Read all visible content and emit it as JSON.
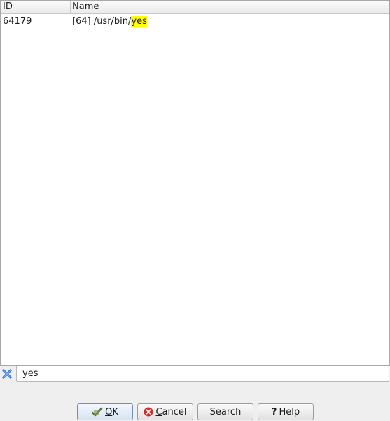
{
  "table": {
    "columns": [
      {
        "label": "ID"
      },
      {
        "label": "Name"
      }
    ],
    "rows": [
      {
        "id": "64179",
        "name_prefix": "[64] /usr/bin/",
        "name_match": "yes"
      }
    ]
  },
  "filter": {
    "value": "yes",
    "highlight_color": "#ffff00"
  },
  "buttons": {
    "ok": {
      "mnemonic": "O",
      "rest": "K"
    },
    "cancel": {
      "mnemonic": "C",
      "rest": "ancel"
    },
    "search": {
      "label": "Search"
    },
    "help": {
      "mnemonic": "?",
      "label": "Help"
    }
  },
  "icons": {
    "clear": "clear-x-icon",
    "ok": "checkmark-icon",
    "cancel": "cancel-circle-icon",
    "help": "question-icon"
  },
  "colors": {
    "clear_icon": "#2d6bd1",
    "cancel_icon": "#d62b2b",
    "ok_icon": "#4a7a2a"
  }
}
